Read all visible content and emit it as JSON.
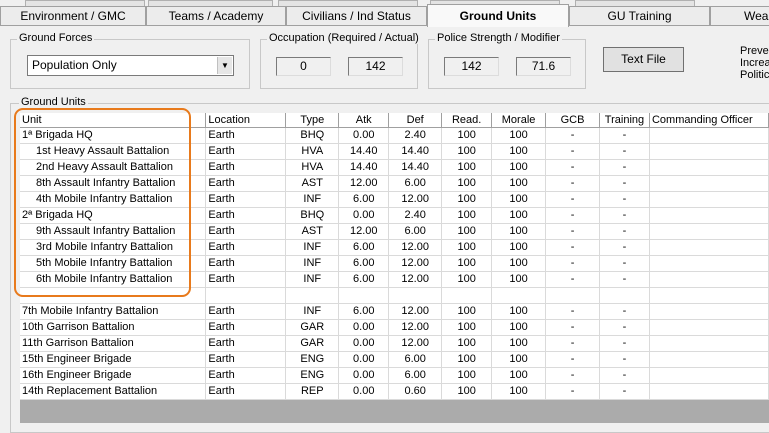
{
  "tabs": [
    {
      "label": "Environment / GMC"
    },
    {
      "label": "Teams / Academy"
    },
    {
      "label": "Civilians / Ind Status"
    },
    {
      "label": "Ground Units"
    },
    {
      "label": "GU Training"
    },
    {
      "label": "Wea"
    }
  ],
  "ground_forces": {
    "label": "Ground Forces",
    "selected": "Population Only"
  },
  "occupation": {
    "label": "Occupation (Required / Actual)",
    "required": "0",
    "actual": "142"
  },
  "police": {
    "label": "Police Strength / Modifier",
    "strength": "142",
    "modifier": "71.6"
  },
  "text_file_button": "Text File",
  "side_text": [
    "Preve",
    "Increa",
    "Politic"
  ],
  "ground_units": {
    "label": "Ground Units",
    "columns": [
      "Unit",
      "Location",
      "Type",
      "Atk",
      "Def",
      "Read.",
      "Morale",
      "GCB",
      "Training",
      "Commanding Officer"
    ],
    "rows": [
      {
        "unit": "1ª Brigada HQ",
        "location": "Earth",
        "type": "BHQ",
        "atk": "0.00",
        "def": "2.40",
        "read": "100",
        "morale": "100",
        "gcb": "-",
        "training": "-",
        "officer": "",
        "indent": false
      },
      {
        "unit": "1st Heavy Assault Battalion",
        "location": "Earth",
        "type": "HVA",
        "atk": "14.40",
        "def": "14.40",
        "read": "100",
        "morale": "100",
        "gcb": "-",
        "training": "-",
        "officer": "",
        "indent": true
      },
      {
        "unit": "2nd Heavy Assault Battalion",
        "location": "Earth",
        "type": "HVA",
        "atk": "14.40",
        "def": "14.40",
        "read": "100",
        "morale": "100",
        "gcb": "-",
        "training": "-",
        "officer": "",
        "indent": true
      },
      {
        "unit": "8th Assault Infantry Battalion",
        "location": "Earth",
        "type": "AST",
        "atk": "12.00",
        "def": "6.00",
        "read": "100",
        "morale": "100",
        "gcb": "-",
        "training": "-",
        "officer": "",
        "indent": true
      },
      {
        "unit": "4th Mobile Infantry Battalion",
        "location": "Earth",
        "type": "INF",
        "atk": "6.00",
        "def": "12.00",
        "read": "100",
        "morale": "100",
        "gcb": "-",
        "training": "-",
        "officer": "",
        "indent": true
      },
      {
        "unit": "2ª Brigada HQ",
        "location": "Earth",
        "type": "BHQ",
        "atk": "0.00",
        "def": "2.40",
        "read": "100",
        "morale": "100",
        "gcb": "-",
        "training": "-",
        "officer": "",
        "indent": false
      },
      {
        "unit": "9th Assault Infantry Battalion",
        "location": "Earth",
        "type": "AST",
        "atk": "12.00",
        "def": "6.00",
        "read": "100",
        "morale": "100",
        "gcb": "-",
        "training": "-",
        "officer": "",
        "indent": true
      },
      {
        "unit": "3rd Mobile Infantry Battalion",
        "location": "Earth",
        "type": "INF",
        "atk": "6.00",
        "def": "12.00",
        "read": "100",
        "morale": "100",
        "gcb": "-",
        "training": "-",
        "officer": "",
        "indent": true
      },
      {
        "unit": "5th Mobile Infantry Battalion",
        "location": "Earth",
        "type": "INF",
        "atk": "6.00",
        "def": "12.00",
        "read": "100",
        "morale": "100",
        "gcb": "-",
        "training": "-",
        "officer": "",
        "indent": true
      },
      {
        "unit": "6th Mobile Infantry Battalion",
        "location": "Earth",
        "type": "INF",
        "atk": "6.00",
        "def": "12.00",
        "read": "100",
        "morale": "100",
        "gcb": "-",
        "training": "-",
        "officer": "",
        "indent": true
      },
      {
        "unit": "",
        "location": "",
        "type": "",
        "atk": "",
        "def": "",
        "read": "",
        "morale": "",
        "gcb": "",
        "training": "",
        "officer": "",
        "indent": false
      },
      {
        "unit": "7th Mobile Infantry Battalion",
        "location": "Earth",
        "type": "INF",
        "atk": "6.00",
        "def": "12.00",
        "read": "100",
        "morale": "100",
        "gcb": "-",
        "training": "-",
        "officer": "",
        "indent": false
      },
      {
        "unit": "10th Garrison Battalion",
        "location": "Earth",
        "type": "GAR",
        "atk": "0.00",
        "def": "12.00",
        "read": "100",
        "morale": "100",
        "gcb": "-",
        "training": "-",
        "officer": "",
        "indent": false
      },
      {
        "unit": "11th Garrison Battalion",
        "location": "Earth",
        "type": "GAR",
        "atk": "0.00",
        "def": "12.00",
        "read": "100",
        "morale": "100",
        "gcb": "-",
        "training": "-",
        "officer": "",
        "indent": false
      },
      {
        "unit": "15th Engineer Brigade",
        "location": "Earth",
        "type": "ENG",
        "atk": "0.00",
        "def": "6.00",
        "read": "100",
        "morale": "100",
        "gcb": "-",
        "training": "-",
        "officer": "",
        "indent": false
      },
      {
        "unit": "16th Engineer Brigade",
        "location": "Earth",
        "type": "ENG",
        "atk": "0.00",
        "def": "6.00",
        "read": "100",
        "morale": "100",
        "gcb": "-",
        "training": "-",
        "officer": "",
        "indent": false
      },
      {
        "unit": "14th Replacement Battalion",
        "location": "Earth",
        "type": "REP",
        "atk": "0.00",
        "def": "0.60",
        "read": "100",
        "morale": "100",
        "gcb": "-",
        "training": "-",
        "officer": "",
        "indent": false
      }
    ]
  },
  "colors": {
    "highlight_box": "#e87a1c",
    "window_bg": "#f0f0f0",
    "grid_empty": "#ababab"
  }
}
